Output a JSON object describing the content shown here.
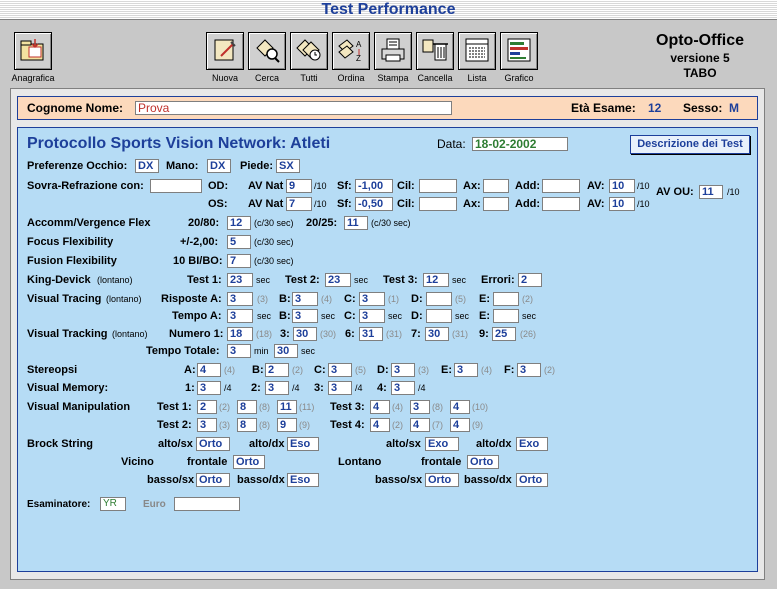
{
  "title": "Test Performance",
  "brand": {
    "name": "Opto-Office",
    "version": "versione 5",
    "sub": "TABO"
  },
  "toolbar": {
    "anagrafica": "Anagrafica",
    "nuova": "Nuova",
    "cerca": "Cerca",
    "tutti": "Tutti",
    "ordina": "Ordina",
    "stampa": "Stampa",
    "cancella": "Cancella",
    "lista": "Lista",
    "grafico": "Grafico"
  },
  "header": {
    "name_label": "Cognome Nome:",
    "name": "Prova",
    "age_label": "Età Esame:",
    "age": "12",
    "sex_label": "Sesso:",
    "sex": "M"
  },
  "protocol": {
    "title": "Protocollo Sports Vision Network: Atleti",
    "date_label": "Data:",
    "date": "18-02-2002",
    "desc_button": "Descrizione dei Test"
  },
  "pref": {
    "label": "Preferenze Occhio:",
    "occhio": "DX",
    "mano_label": "Mano:",
    "mano": "DX",
    "piede_label": "Piede:",
    "piede": "SX"
  },
  "refr": {
    "label": "Sovra-Refrazione con:",
    "value": "",
    "od": "OD:",
    "os": "OS:",
    "avnat": "AV Nat",
    "sf": "Sf:",
    "cil": "Cil:",
    "ax": "Ax:",
    "add": "Add:",
    "av": "AV:",
    "ten": "/10",
    "avou": "AV OU:",
    "od_avnat": "9",
    "od_sf": "-1,00",
    "od_av": "10",
    "os_avnat": "7",
    "os_sf": "-0,50",
    "os_av": "10",
    "ou": "11"
  },
  "accomm": {
    "label": "Accomm/Vergence Flex",
    "l1": "20/80:",
    "v1": "12",
    "unit": "(c/30 sec)",
    "l2": "20/25:",
    "v2": "11"
  },
  "focus": {
    "label": "Focus Flexibility",
    "l": "+/-2,00:",
    "v": "5"
  },
  "fusion": {
    "label": "Fusion Flexibility",
    "l": "10 BI/BO:",
    "v": "7"
  },
  "kd": {
    "label": "King-Devick",
    "note": "(lontano)",
    "t1": "Test 1:",
    "v1": "23",
    "t2": "Test 2:",
    "v2": "23",
    "t3": "Test 3:",
    "v3": "12",
    "sec": "sec",
    "err_label": "Errori:",
    "err": "2"
  },
  "vtracing": {
    "label": "Visual Tracing",
    "note": "(lontano)",
    "risp": "Risposte A:",
    "tempo": "Tempo A:",
    "sec": "sec",
    "b": "B:",
    "c": "C:",
    "d": "D:",
    "e": "E:",
    "ra": "3",
    "ra_g": "(3)",
    "rb": "3",
    "rb_g": "(4)",
    "rc": "3",
    "rc_g": "(1)",
    "rd_g": "(5)",
    "re_g": "(2)",
    "ta": "3",
    "tb": "3",
    "tc": "3"
  },
  "vtracking": {
    "label": "Visual Tracking",
    "note": "(lontano)",
    "num": "Numero 1:",
    "v1": "18",
    "g1": "(18)",
    "l3": "3:",
    "v3": "30",
    "g3": "(30)",
    "l6": "6:",
    "v6": "31",
    "g6": "(31)",
    "l7": "7:",
    "v7": "30",
    "g7": "(31)",
    "l9": "9:",
    "v9": "25",
    "g9": "(26)",
    "total_label": "Tempo Totale:",
    "min": "3",
    "min_u": "min",
    "sec": "30",
    "sec_u": "sec"
  },
  "stereo": {
    "label": "Stereopsi",
    "a": "A:",
    "va": "4",
    "ga": "(4)",
    "b": "B:",
    "vb": "2",
    "gb": "(2)",
    "c": "C:",
    "vc": "3",
    "gc": "(5)",
    "d": "D:",
    "vd": "3",
    "gd": "(3)",
    "e": "E:",
    "ve": "3",
    "ge": "(4)",
    "f": "F:",
    "vf": "3",
    "gf": "(2)"
  },
  "vmem": {
    "label": "Visual Memory:",
    "l1": "1:",
    "v1": "3",
    "l2": "2:",
    "v2": "3",
    "l3": "3:",
    "v3": "3",
    "l4": "4:",
    "v4": "3",
    "u": "/4"
  },
  "vmanip": {
    "label": "Visual Manipulation",
    "t1": "Test 1:",
    "t2": "Test 2:",
    "t3": "Test 3:",
    "t4": "Test 4:",
    "a1": "2",
    "a1g": "(2)",
    "a2": "8",
    "a2g": "(8)",
    "a3": "11",
    "a3g": "(11)",
    "b1": "3",
    "b1g": "(3)",
    "b2": "8",
    "b2g": "(8)",
    "b3": "9",
    "b3g": "(9)",
    "c1": "4",
    "c1g": "(4)",
    "c2": "3",
    "c2g": "(8)",
    "c3": "4",
    "c3g": "(10)",
    "d1": "4",
    "d1g": "(2)",
    "d2": "4",
    "d2g": "(7)",
    "d3": "4",
    "d3g": "(9)"
  },
  "brock": {
    "label": "Brock String",
    "altosx": "alto/sx",
    "altodx": "alto/dx",
    "bassosx": "basso/sx",
    "bassodx": "basso/dx",
    "frontale": "frontale",
    "vicino": "Vicino",
    "lontano": "Lontano",
    "v_asx": "Orto",
    "v_adx": "Eso",
    "v_fr": "Orto",
    "v_bsx": "Orto",
    "v_bdx": "Eso",
    "l_asx": "Exo",
    "l_adx": "Exo",
    "l_fr": "Orto",
    "l_bsx": "Orto",
    "l_bdx": "Orto"
  },
  "footer": {
    "esam_label": "Esaminatore:",
    "esam": "YR",
    "euro_label": "Euro",
    "euro": ""
  }
}
